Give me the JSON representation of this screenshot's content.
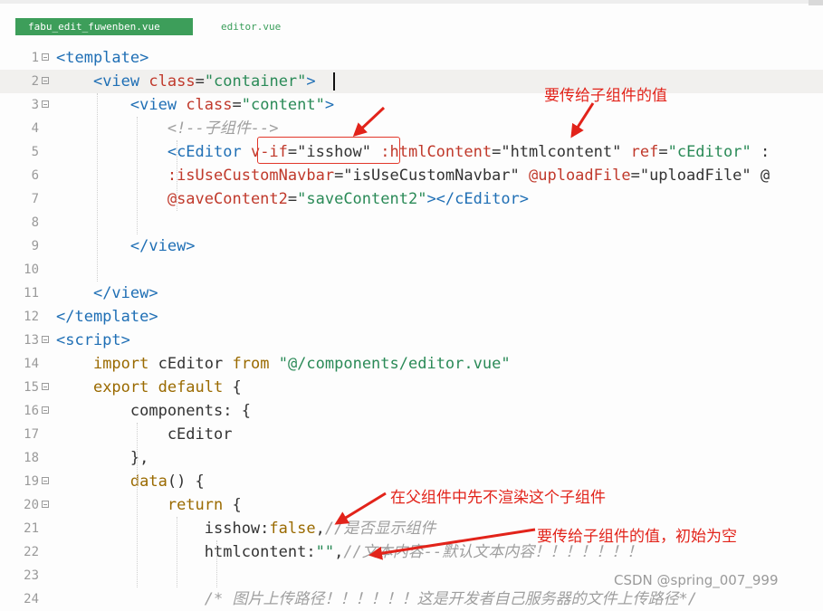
{
  "tabs": {
    "active": "fabu_edit_fuwenben.vue",
    "inactive": "editor.vue"
  },
  "lines": [
    {
      "n": "1",
      "fold": true,
      "tokens": [
        [
          "tg",
          "<template>"
        ]
      ]
    },
    {
      "n": "2",
      "fold": true,
      "tokens": [
        [
          "pl",
          "    "
        ],
        [
          "tg",
          "<view "
        ],
        [
          "at",
          "class"
        ],
        [
          "pl",
          "="
        ],
        [
          "st",
          "\"container\""
        ],
        [
          "tg",
          ">"
        ]
      ]
    },
    {
      "n": "3",
      "fold": true,
      "tokens": [
        [
          "pl",
          "        "
        ],
        [
          "tg",
          "<view "
        ],
        [
          "at",
          "class"
        ],
        [
          "pl",
          "="
        ],
        [
          "st",
          "\"content\""
        ],
        [
          "tg",
          ">"
        ]
      ]
    },
    {
      "n": "4",
      "fold": false,
      "tokens": [
        [
          "pl",
          "            "
        ],
        [
          "cm",
          "<!--子组件-->"
        ]
      ]
    },
    {
      "n": "5",
      "fold": false,
      "tokens": [
        [
          "pl",
          "            "
        ],
        [
          "tg",
          "<cEditor "
        ],
        [
          "at",
          "v-if"
        ],
        [
          "pl",
          "=\"isshow\" "
        ],
        [
          "at",
          ":htmlContent"
        ],
        [
          "pl",
          "=\"htmlcontent\" "
        ],
        [
          "at",
          "ref"
        ],
        [
          "pl",
          "="
        ],
        [
          "st",
          "\"cEditor\""
        ],
        [
          "pl",
          " :"
        ]
      ]
    },
    {
      "n": "6",
      "fold": false,
      "tokens": [
        [
          "pl",
          "            "
        ],
        [
          "at",
          ":isUseCustomNavbar"
        ],
        [
          "pl",
          "=\"isUseCustomNavbar\" "
        ],
        [
          "at",
          "@uploadFile"
        ],
        [
          "pl",
          "=\"uploadFile\" @"
        ]
      ]
    },
    {
      "n": "7",
      "fold": false,
      "tokens": [
        [
          "pl",
          "            "
        ],
        [
          "at",
          "@saveContent2"
        ],
        [
          "pl",
          "="
        ],
        [
          "st",
          "\"saveContent2\""
        ],
        [
          "tg",
          "></cEditor>"
        ]
      ]
    },
    {
      "n": "8",
      "fold": false,
      "tokens": []
    },
    {
      "n": "9",
      "fold": false,
      "tokens": [
        [
          "pl",
          "        "
        ],
        [
          "tg",
          "</view>"
        ]
      ]
    },
    {
      "n": "10",
      "fold": false,
      "tokens": []
    },
    {
      "n": "11",
      "fold": false,
      "tokens": [
        [
          "pl",
          "    "
        ],
        [
          "tg",
          "</view>"
        ]
      ]
    },
    {
      "n": "12",
      "fold": false,
      "tokens": [
        [
          "tg",
          "</template>"
        ]
      ]
    },
    {
      "n": "13",
      "fold": true,
      "tokens": [
        [
          "tg",
          "<script>"
        ]
      ]
    },
    {
      "n": "14",
      "fold": false,
      "tokens": [
        [
          "pl",
          "    "
        ],
        [
          "km",
          "import"
        ],
        [
          "pl",
          " cEditor "
        ],
        [
          "km",
          "from"
        ],
        [
          "pl",
          " "
        ],
        [
          "st",
          "\"@/components/editor.vue\""
        ]
      ]
    },
    {
      "n": "15",
      "fold": true,
      "tokens": [
        [
          "pl",
          "    "
        ],
        [
          "km",
          "export default"
        ],
        [
          "pl",
          " {"
        ]
      ]
    },
    {
      "n": "16",
      "fold": true,
      "tokens": [
        [
          "pl",
          "        components: {"
        ]
      ]
    },
    {
      "n": "17",
      "fold": false,
      "tokens": [
        [
          "pl",
          "            cEditor"
        ]
      ]
    },
    {
      "n": "18",
      "fold": false,
      "tokens": [
        [
          "pl",
          "        },"
        ]
      ]
    },
    {
      "n": "19",
      "fold": true,
      "tokens": [
        [
          "pl",
          "        "
        ],
        [
          "km",
          "data"
        ],
        [
          "pl",
          "() {"
        ]
      ]
    },
    {
      "n": "20",
      "fold": true,
      "tokens": [
        [
          "pl",
          "            "
        ],
        [
          "km",
          "return"
        ],
        [
          "pl",
          " {"
        ]
      ]
    },
    {
      "n": "21",
      "fold": false,
      "tokens": [
        [
          "pl",
          "                isshow:"
        ],
        [
          "km",
          "false"
        ],
        [
          "pl",
          ","
        ],
        [
          "cm",
          "//是否显示组件"
        ]
      ]
    },
    {
      "n": "22",
      "fold": false,
      "tokens": [
        [
          "pl",
          "                htmlcontent:"
        ],
        [
          "st",
          "\"\""
        ],
        [
          "pl",
          ","
        ],
        [
          "cm",
          "//文本内容--默认文本内容！！！！！！！"
        ]
      ]
    },
    {
      "n": "23",
      "fold": false,
      "tokens": []
    },
    {
      "n": "24",
      "fold": false,
      "tokens": [
        [
          "pl",
          "                "
        ],
        [
          "cm",
          "/* 图片上传路径！！！！！！这是开发者自己服务器的文件上传路径*/"
        ]
      ]
    }
  ],
  "annotations": {
    "a1": "要传给子组件的值",
    "a2": "在父组件中先不渲染这个子组件",
    "a3": "要传给子组件的值，初始为空"
  },
  "watermark": "CSDN @spring_007_999",
  "colors": {
    "tab_active": "#3d9e5a",
    "tag": "#1f6fb5",
    "attribute": "#c0392b",
    "string": "#2a8a57",
    "keyword": "#9a6a00",
    "comment": "#9f9f9f",
    "annotation_red": "#e2231a"
  }
}
